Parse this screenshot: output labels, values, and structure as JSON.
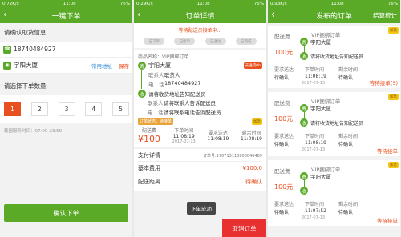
{
  "screen1": {
    "status": {
      "left": "0.72K/s",
      "time": "11:08",
      "right": "76%"
    },
    "title": "一键下单",
    "confirm_pickup_label": "请确认取货信息",
    "phone": "18740484927",
    "address": "宇阳大厦",
    "common_address_link": "常用地址",
    "save_link": "保存",
    "quantity_label": "请选择下单数量",
    "quantity_options": [
      "1",
      "2",
      "3",
      "4",
      "5"
    ],
    "selected_quantity": "1",
    "service_hours": "截图服务时间：07:00-23:59",
    "confirm_button": "确认下单",
    "colors": {
      "brand": "#5aaa28",
      "accent": "#e8501f"
    }
  },
  "screen2": {
    "status": {
      "left": "0.29K/s",
      "time": "11:08",
      "right": "75%"
    },
    "title": "订单详情",
    "waiting_notice": "等待配送员接单中...",
    "steps": [
      "已下单",
      "已接单",
      "已送达",
      "已完成"
    ],
    "shop_label": "商品名称：VIP捆绑订单",
    "sender": {
      "name": "宇阳大厦",
      "contact_label": "联系人",
      "contact_value": "联货人",
      "phone_label": "电　话",
      "phone_value": "18740484927"
    },
    "countdown": "去送货0h",
    "receiver": {
      "name": "请将收货地址告知配送员",
      "contact_label": "联系人",
      "contact_value": "请将联系人告诉配送员",
      "phone_label": "电　话",
      "phone_value": "请将联系电话告诉配送员"
    },
    "prepaid_badge": "订单状态：待接单",
    "expedited_tag": "加急",
    "metrics": [
      {
        "label": "配送费",
        "value": "¥100"
      },
      {
        "label": "下单时间",
        "value": "11:08:19"
      },
      {
        "label": "要求送达",
        "value": "11:08:19"
      },
      {
        "label": "剩余时间",
        "value": "11:08:19"
      }
    ],
    "date": "2017-07-13",
    "payment_title": "支付详情",
    "order_no": "订单号:170713110800040489",
    "base_fee_label": "基本费用",
    "base_fee_value": "¥100.0",
    "distance_label": "配送距离",
    "distance_value": "待确认",
    "toast": "下单成功",
    "cancel_button": "取消订单"
  },
  "screen3": {
    "status": {
      "left": "0.93K/s",
      "time": "11:08",
      "right": "76%"
    },
    "title": "发布的订单",
    "right_link": "结算统计",
    "cards": [
      {
        "fee_label": "配送费",
        "fee": "100元",
        "shop": "VIP捆绑订单",
        "address": "宇阳大厦",
        "receiver": "请将收货地址告知配送员",
        "col1_label": "要求送达",
        "col1_value": "待确认",
        "col2_label": "下单时间",
        "col2_value": "11:08:19",
        "col3_label": "剩余时间",
        "col3_value": "待确认",
        "date": "2017-07-13",
        "status": "等待接单(5)",
        "tag": "加急"
      },
      {
        "fee_label": "配送费",
        "fee": "100元",
        "shop": "VIP捆绑订单",
        "address": "宇阳大厦",
        "receiver": "请将收货地址告知配送员",
        "col1_label": "要求送达",
        "col1_value": "待确认",
        "col2_label": "下单时间",
        "col2_value": "11:08:19",
        "col3_label": "剩余时间",
        "col3_value": "待确认",
        "date": "2017-07-13",
        "status": "等待接单",
        "tag": "加急"
      },
      {
        "fee_label": "配送费",
        "fee": "100元",
        "shop": "VIP捆绑订单",
        "address": "宇阳大厦",
        "receiver": "",
        "col1_label": "要求送达",
        "col1_value": "待确认",
        "col2_label": "下单时间",
        "col2_value": "11:07:52",
        "col3_label": "剩余时间",
        "col3_value": "待确认",
        "date": "2017-07-13",
        "status": "等待接单",
        "tag": "加急"
      }
    ]
  }
}
